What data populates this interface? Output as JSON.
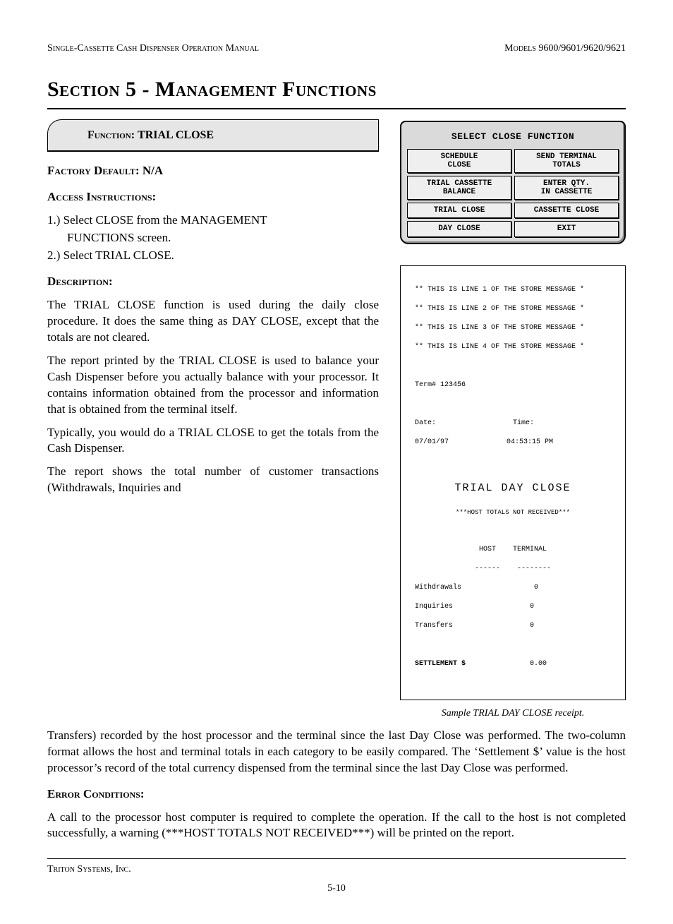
{
  "header": {
    "left": "Single-Cassette Cash Dispenser Operation Manual",
    "right": "Models 9600/9601/9620/9621"
  },
  "section_title": "Section 5 - Management Functions",
  "function_tab": {
    "label": "Function:",
    "name": "TRIAL CLOSE"
  },
  "factory_default": {
    "label": "Factory Default:",
    "value": "N/A"
  },
  "access": {
    "label": "Access Instructions:",
    "steps": {
      "s1a": "1.) Select CLOSE from the MANAGEMENT",
      "s1b": "FUNCTIONS screen.",
      "s2": "2.) Select TRIAL CLOSE."
    }
  },
  "description_label": "Description:",
  "desc_p1": "The TRIAL CLOSE function is used during the daily close procedure.  It does the same thing as DAY CLOSE, except that the totals are not cleared.",
  "desc_p2": "The report printed by the TRIAL CLOSE is used to balance your Cash Dispenser before you actually balance with your processor.  It contains information obtained from the processor and information that is obtained from the terminal itself.",
  "desc_p3": "Typically, you would do a TRIAL CLOSE to get the totals from the Cash Dispenser.",
  "desc_p4a": "The report shows the total number of customer transactions (Withdrawals, Inquiries and",
  "desc_p4b": "Transfers) recorded by the host processor and the terminal since the last Day Close was performed. The two-column format allows the host and terminal totals in each category to be easily compared. The ‘Settlement $’ value is the host processor’s record of  the total currency dispensed from the terminal since the last Day Close was performed.",
  "error_label": "Error Conditions:",
  "error_p": "A call to the processor host computer is required to complete the operation.  If the call to the host is not completed successfully, a warning (***HOST TOTALS NOT RECEIVED***) will be printed on the report.",
  "atm": {
    "title": "SELECT CLOSE FUNCTION",
    "buttons": [
      "SCHEDULE\nCLOSE",
      "SEND TERMINAL\nTOTALS",
      "TRIAL CASSETTE\nBALANCE",
      "ENTER QTY.\nIN CASSETTE",
      "TRIAL CLOSE",
      "CASSETTE CLOSE",
      "DAY CLOSE",
      "EXIT"
    ]
  },
  "receipt": {
    "msg1": "** THIS IS LINE 1 OF THE STORE MESSAGE *",
    "msg2": "** THIS IS LINE 2 OF THE STORE MESSAGE *",
    "msg3": "** THIS IS LINE 3 OF THE STORE MESSAGE *",
    "msg4": "** THIS IS LINE 4 OF THE STORE MESSAGE *",
    "term": "Term# 123456",
    "date_lbl": "Date:",
    "time_lbl": "Time:",
    "date_val": "07/01/97",
    "time_val": "04:53:15 PM",
    "title": "TRIAL DAY CLOSE",
    "not_received": "***HOST TOTALS NOT RECEIVED***",
    "col_host": "HOST",
    "col_term": "TERMINAL",
    "dash": "------    --------",
    "rows": [
      {
        "label": "Withdrawals",
        "val": "0"
      },
      {
        "label": "Inquiries",
        "val": "0"
      },
      {
        "label": "Transfers",
        "val": "0"
      }
    ],
    "settlement_lbl": "SETTLEMENT $",
    "settlement_val": "0.00"
  },
  "receipt_caption": "Sample TRIAL DAY CLOSE  receipt.",
  "footer": {
    "company": "Triton Systems, Inc.",
    "page": "5-10"
  }
}
